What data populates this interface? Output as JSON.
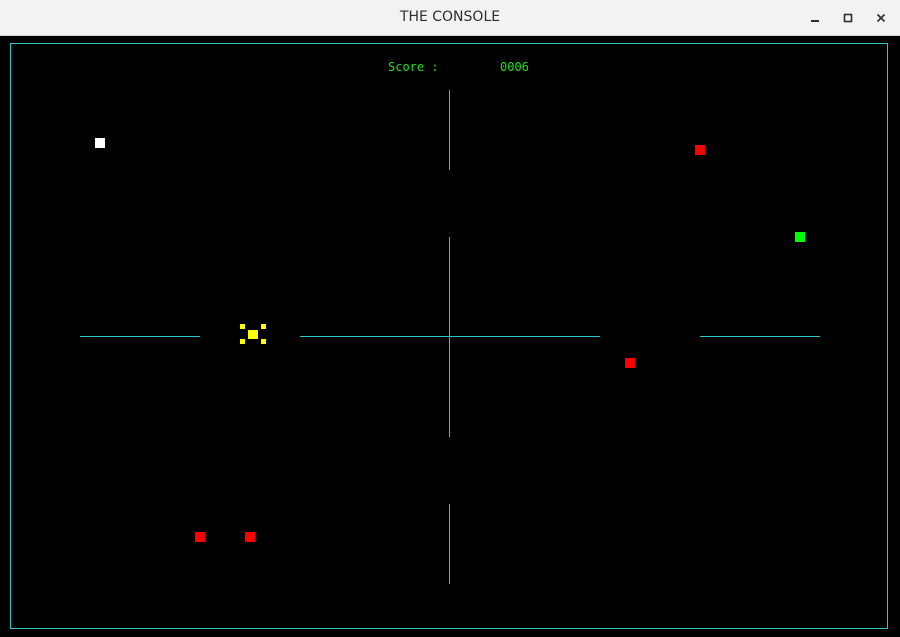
{
  "window": {
    "title": "THE CONSOLE",
    "controls": [
      "minimize-icon",
      "maximize-icon",
      "close-icon"
    ]
  },
  "colors": {
    "background": "#000000",
    "playfield_lines": "#29c6c6",
    "score_text": "#22dd22",
    "player": "#ffff00",
    "wall_block": "#ffffff",
    "enemy": "#ff0000",
    "target": "#00ff00"
  },
  "hud": {
    "score_label": "Score :",
    "score_value": "0006"
  },
  "entities": {
    "player": "yellow-player",
    "items": [
      {
        "type": "white-block"
      },
      {
        "type": "red-enemy"
      },
      {
        "type": "green-target"
      },
      {
        "type": "red-enemy"
      },
      {
        "type": "red-enemy"
      },
      {
        "type": "red-enemy"
      }
    ]
  }
}
